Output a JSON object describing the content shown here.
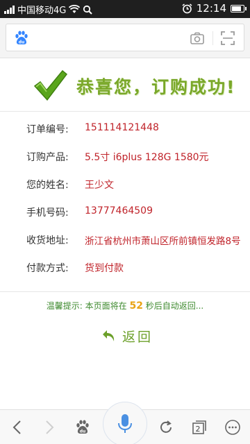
{
  "status_bar": {
    "carrier": "中国移动4G",
    "time": "12:14"
  },
  "search": {
    "placeholder": ""
  },
  "success": {
    "title": "恭喜您，订购成功!"
  },
  "order": {
    "rows": [
      {
        "label": "订单编号:",
        "value": "151114121448"
      },
      {
        "label": "订购产品:",
        "value": "5.5寸 i6plus 128G 1580元"
      },
      {
        "label": "您的姓名:",
        "value": "王少文"
      },
      {
        "label": "手机号码:",
        "value": "13777464509"
      },
      {
        "label": "收货地址:",
        "value": "浙江省杭州市萧山区所前镇恒发路8号"
      },
      {
        "label": "付款方式:",
        "value": "货到付款"
      }
    ]
  },
  "notice": {
    "prefix": "温馨提示: 本页面将在 ",
    "seconds": "52",
    "suffix": " 秒后自动返回..."
  },
  "back_label": "返回",
  "nav": {
    "tab_count": "2"
  },
  "colors": {
    "accent_green": "#7aa82a",
    "value_red": "#c0232a",
    "countdown_orange": "#e8a315"
  }
}
